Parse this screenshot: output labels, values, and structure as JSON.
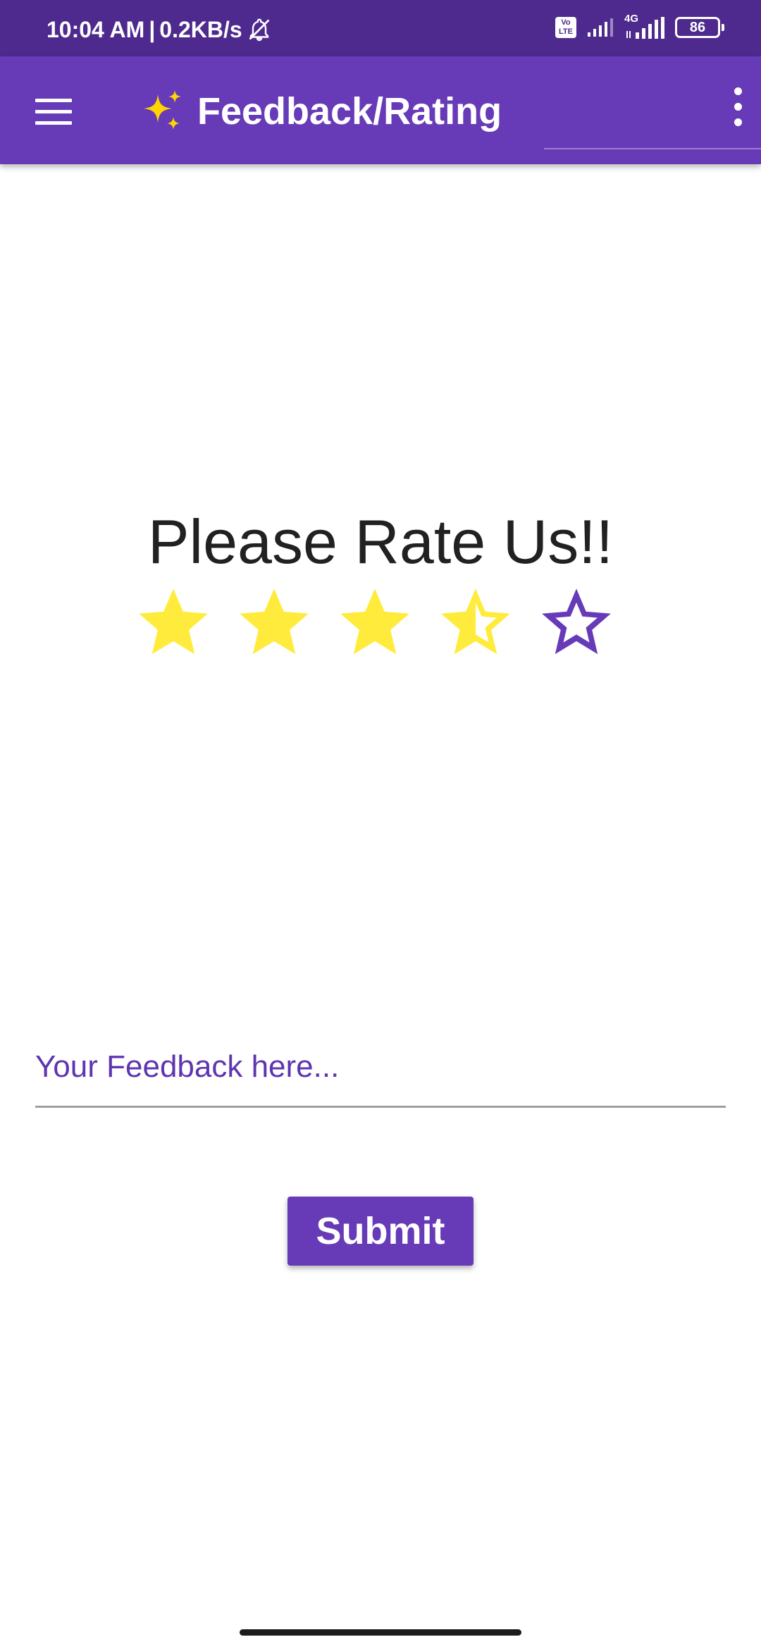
{
  "status_bar": {
    "time": "10:04 AM",
    "separator": "|",
    "network_speed": "0.2KB/s",
    "mute_icon": "bell-off-icon",
    "volte_label": "Vo LTE",
    "network_type": "4G",
    "battery_level": "86"
  },
  "app_bar": {
    "menu_icon": "hamburger-menu-icon",
    "title_icon": "sparkles-icon",
    "title": "Feedback/Rating",
    "overflow_icon": "more-vertical-icon"
  },
  "rating": {
    "heading": "Please Rate Us!!",
    "value": 3.5,
    "max": 5,
    "filled_color": "#ffeb3b",
    "empty_outline_color": "#673ab7"
  },
  "feedback": {
    "value": "",
    "placeholder": "Your Feedback here..."
  },
  "submit": {
    "label": "Submit"
  },
  "colors": {
    "primary": "#673ab7",
    "status_bar": "#4e2a8e",
    "star": "#ffeb3b",
    "hint": "#5e35b1"
  }
}
